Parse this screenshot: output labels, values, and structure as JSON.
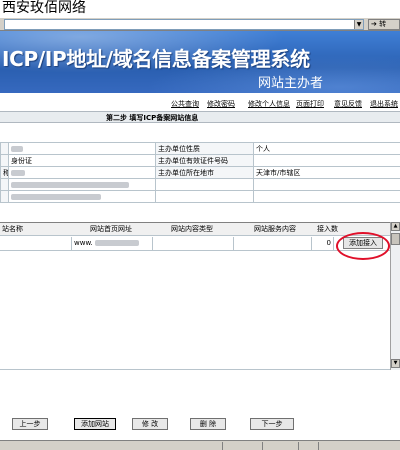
{
  "window": {
    "caption": "西安玫佰网络"
  },
  "addressbar": {
    "go_label": "转"
  },
  "banner": {
    "title": "ICP/IP地址/域名信息备案管理系统",
    "subtitle": "网站主办者"
  },
  "toplinks": [
    "公共查询",
    "修改密码",
    "修改个人信息",
    "页面打印",
    "意见反馈",
    "退出系统"
  ],
  "step_title": "第二步 填写ICP备案网站信息",
  "info": {
    "row1": {
      "right_label": "主办单位性质",
      "right_value": "个人"
    },
    "row2": {
      "left_value": "身份证",
      "right_label": "主办单位有效证件号码"
    },
    "row3": {
      "left_suffix": "称",
      "right_label": "主办单位所在地市",
      "right_value": "天津市/市辖区"
    }
  },
  "grid": {
    "headers": [
      "站名称",
      "网站首页网址",
      "网站内容类型",
      "网站服务内容",
      "接入数"
    ],
    "row": {
      "url_prefix": "www.",
      "count": "0",
      "action": "添加接入"
    }
  },
  "buttons": {
    "prev": "上一步",
    "add_site": "添加网站",
    "edit": "修  改",
    "delete": "删  除",
    "next": "下一步"
  }
}
